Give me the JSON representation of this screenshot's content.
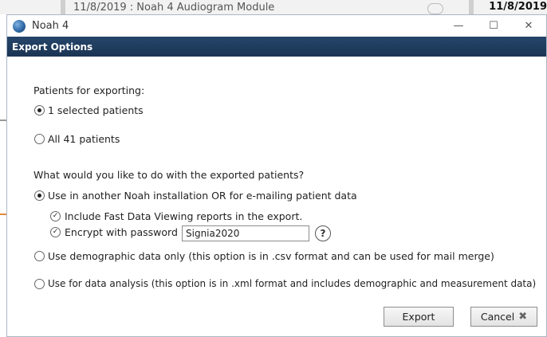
{
  "background": {
    "strip_text": "11/8/2019 : Noah 4 Audiogram Module",
    "date_text": "11/8/2019"
  },
  "window": {
    "title": "Noah 4",
    "header": "Export Options",
    "minimize_glyph": "—",
    "maximize_glyph": "☐",
    "close_glyph": "✕"
  },
  "patients": {
    "label": "Patients for exporting:",
    "options": [
      {
        "label": "1 selected patients",
        "selected": true
      },
      {
        "label": "All 41 patients",
        "selected": false
      }
    ]
  },
  "usage": {
    "label": "What would you like to do with the exported patients?",
    "options": [
      {
        "label": "Use in another Noah installation OR for e-mailing patient data",
        "selected": true
      },
      {
        "label": "Use demographic data only (this option is in .csv format and can be used for mail merge)",
        "selected": false
      },
      {
        "label": "Use for data analysis (this option is in .xml format and includes demographic and measurement data)",
        "selected": false
      }
    ],
    "include_fast_data": {
      "label": "Include Fast Data Viewing reports in the export.",
      "checked": true
    },
    "encrypt": {
      "label": "Encrypt with password",
      "checked": true,
      "password": "Signia2020"
    },
    "help_glyph": "?"
  },
  "buttons": {
    "export": "Export",
    "cancel": "Cancel"
  },
  "colors": {
    "header_bg": "#1b3553",
    "accent": "#2f6aa7"
  }
}
